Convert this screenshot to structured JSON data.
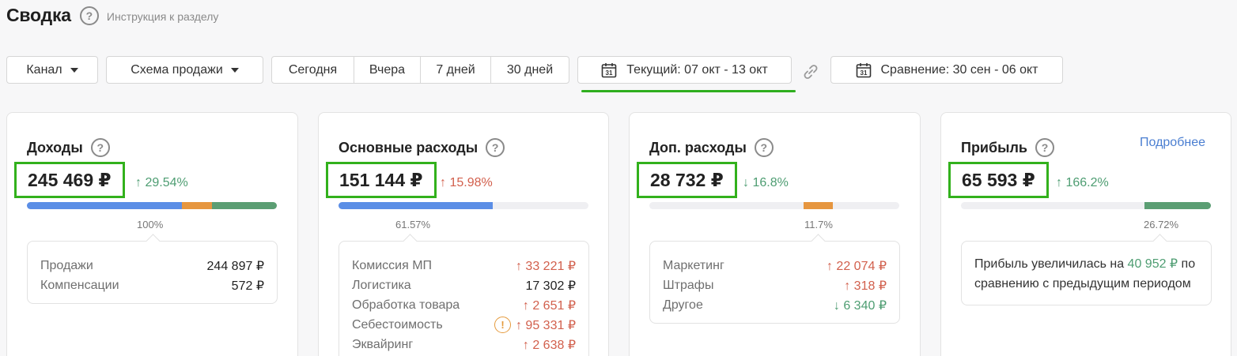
{
  "header": {
    "title": "Сводка",
    "instruction": "Инструкция к разделу"
  },
  "filters": {
    "channel": "Канал",
    "scheme": "Схема продажи",
    "periods": [
      "Сегодня",
      "Вчера",
      "7 дней",
      "30 дней"
    ],
    "current": "Текущий: 07 окт - 13 окт",
    "compare": "Сравнение: 30 сен - 06 окт",
    "calendar_day": "31"
  },
  "cards": {
    "income": {
      "title": "Доходы",
      "amount": "245 469 ₽",
      "delta": "↑ 29.54%",
      "percent": "100%",
      "segments": [
        0.62,
        0.12,
        0.26
      ],
      "rows": [
        {
          "label": "Продажи",
          "value": "244 897 ₽"
        },
        {
          "label": "Компенсации",
          "value": "572 ₽"
        }
      ]
    },
    "main_expenses": {
      "title": "Основные расходы",
      "amount": "151 144 ₽",
      "delta": "↑ 15.98%",
      "percent": "61.57%",
      "fill": 0.6157,
      "rows": [
        {
          "label": "Комиссия МП",
          "value": "↑ 33 221 ₽"
        },
        {
          "label": "Логистика",
          "value": "17 302 ₽"
        },
        {
          "label": "Обработка товара",
          "value": "↑ 2 651 ₽"
        },
        {
          "label": "Себестоимость",
          "value": "↑ 95 331 ₽",
          "warning": "!"
        },
        {
          "label": "Эквайринг",
          "value": "↑ 2 638 ₽"
        }
      ]
    },
    "extra_expenses": {
      "title": "Доп. расходы",
      "amount": "28 732 ₽",
      "delta": "↓ 16.8%",
      "percent": "11.7%",
      "fill": 0.117,
      "rows": [
        {
          "label": "Маркетинг",
          "value": "↑ 22 074 ₽"
        },
        {
          "label": "Штрафы",
          "value": "↑ 318 ₽"
        },
        {
          "label": "Другое",
          "value": "↓ 6 340 ₽"
        }
      ]
    },
    "profit": {
      "title": "Прибыль",
      "more": "Подробнее",
      "amount": "65 593 ₽",
      "delta": "↑ 166.2%",
      "percent": "26.72%",
      "fill": 0.2672,
      "text_before": "Прибыль увеличилась на ",
      "text_num": "40 952 ₽",
      "text_after": " по сравнению с предыдущим периодом"
    }
  },
  "colors": {
    "blue": "#5b8ee6",
    "orange": "#e6963f",
    "green": "#5b9e73",
    "highlight": "#32b11c"
  }
}
